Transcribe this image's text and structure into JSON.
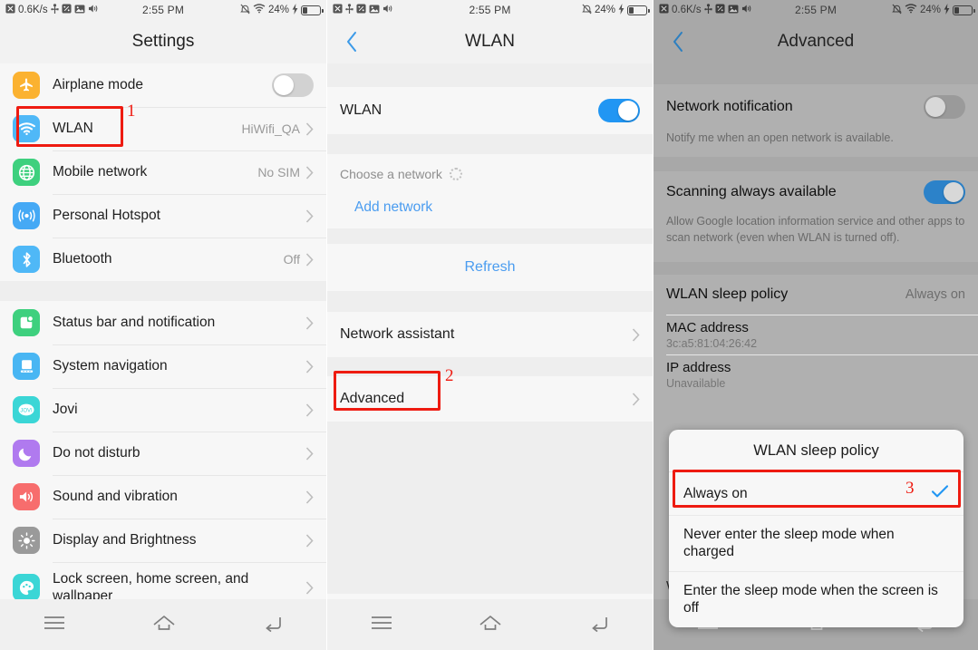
{
  "panels": [
    {
      "id": "settings",
      "statusbar": {
        "speed": "0.6K/s",
        "time": "2:55 PM",
        "battery_percent": "24%",
        "icons_left": [
          "signal-x-icon",
          "usb-icon",
          "developer-icon",
          "screenshot-icon",
          "volume-icon"
        ],
        "icons_right": [
          "mute-icon",
          "wifi-icon",
          "charging-bolt-icon",
          "battery-icon"
        ]
      },
      "title": "Settings",
      "groups": [
        {
          "rows": [
            {
              "icon": "airplane-icon",
              "icon_color": "#fbb231",
              "label": "Airplane mode",
              "control": "toggle",
              "toggle_on": false
            },
            {
              "icon": "wifi-icon",
              "icon_color": "#4fb8f7",
              "label": "WLAN",
              "value": "HiWifi_QA",
              "control": "chevron"
            },
            {
              "icon": "globe-icon",
              "icon_color": "#3ed07e",
              "label": "Mobile network",
              "value": "No SIM",
              "control": "chevron"
            },
            {
              "icon": "hotspot-icon",
              "icon_color": "#45a9f5",
              "label": "Personal Hotspot",
              "value": "",
              "control": "chevron"
            },
            {
              "icon": "bluetooth-icon",
              "icon_color": "#4fb8f7",
              "label": "Bluetooth",
              "value": "Off",
              "control": "chevron"
            }
          ]
        },
        {
          "rows": [
            {
              "icon": "statusbar-icon",
              "icon_color": "#3ed07e",
              "label": "Status bar and notification",
              "value": "",
              "control": "chevron"
            },
            {
              "icon": "navigation-icon",
              "icon_color": "#49b6f3",
              "label": "System navigation",
              "value": "",
              "control": "chevron"
            },
            {
              "icon": "jovi-icon",
              "icon_color": "#3bd6d6",
              "label": "Jovi",
              "value": "",
              "control": "chevron"
            },
            {
              "icon": "moon-icon",
              "icon_color": "#b07aef",
              "label": "Do not disturb",
              "value": "",
              "control": "chevron"
            },
            {
              "icon": "speaker-icon",
              "icon_color": "#f76d6d",
              "label": "Sound and vibration",
              "value": "",
              "control": "chevron"
            },
            {
              "icon": "brightness-icon",
              "icon_color": "#9a9a9a",
              "label": "Display and Brightness",
              "value": "",
              "control": "chevron"
            },
            {
              "icon": "wallpaper-icon",
              "icon_color": "#3bd6d6",
              "label": "Lock screen, home screen, and wallpaper",
              "value": "",
              "control": "chevron"
            }
          ]
        }
      ],
      "nav": [
        "menu-icon",
        "home-icon",
        "back-icon"
      ]
    },
    {
      "id": "wlan",
      "statusbar": {
        "speed": "",
        "time": "2:55 PM",
        "battery_percent": "24%"
      },
      "title": "WLAN",
      "back": "back-chevron-icon",
      "wlan_row_label": "WLAN",
      "wlan_toggle_on": true,
      "section_header": "Choose a network",
      "add_network": "Add network",
      "refresh": "Refresh",
      "network_assistant": "Network assistant",
      "advanced": "Advanced",
      "nav": [
        "menu-icon",
        "home-icon",
        "back-icon"
      ]
    },
    {
      "id": "advanced",
      "statusbar": {
        "speed": "0.6K/s",
        "time": "2:55 PM",
        "battery_percent": "24%"
      },
      "title": "Advanced",
      "back": "back-chevron-icon",
      "rows": [
        {
          "label": "Network notification",
          "control": "toggle",
          "toggle_on": false,
          "desc": "Notify me when an open network is available."
        },
        {
          "label": "Scanning always available",
          "control": "toggle",
          "toggle_on": true,
          "desc": "Allow Google location information service and other apps to scan network (even when WLAN is turned off)."
        }
      ],
      "sleep_policy_label": "WLAN sleep policy",
      "sleep_policy_value": "Always on",
      "mac_label": "MAC address",
      "mac_value": "3c:a5:81:04:26:42",
      "ip_label": "IP address",
      "ip_value": "Unavailable",
      "behind_text": "WLAN sleep policy",
      "dialog": {
        "title": "WLAN sleep policy",
        "options": [
          {
            "label": "Always on",
            "selected": true
          },
          {
            "label": "Never enter the sleep mode when charged",
            "selected": false
          },
          {
            "label": "Enter the sleep mode when the screen is off",
            "selected": false
          }
        ]
      },
      "nav": [
        "menu-icon",
        "home-icon",
        "back-icon"
      ]
    }
  ],
  "annotations": [
    {
      "number": "1",
      "target": "wlan-settings-row"
    },
    {
      "number": "2",
      "target": "advanced-row"
    },
    {
      "number": "3",
      "target": "always-on-option"
    }
  ],
  "colors": {
    "accent_blue": "#2196f3",
    "link_blue": "#4a9cf0",
    "annotation_red": "#ee1b11"
  }
}
